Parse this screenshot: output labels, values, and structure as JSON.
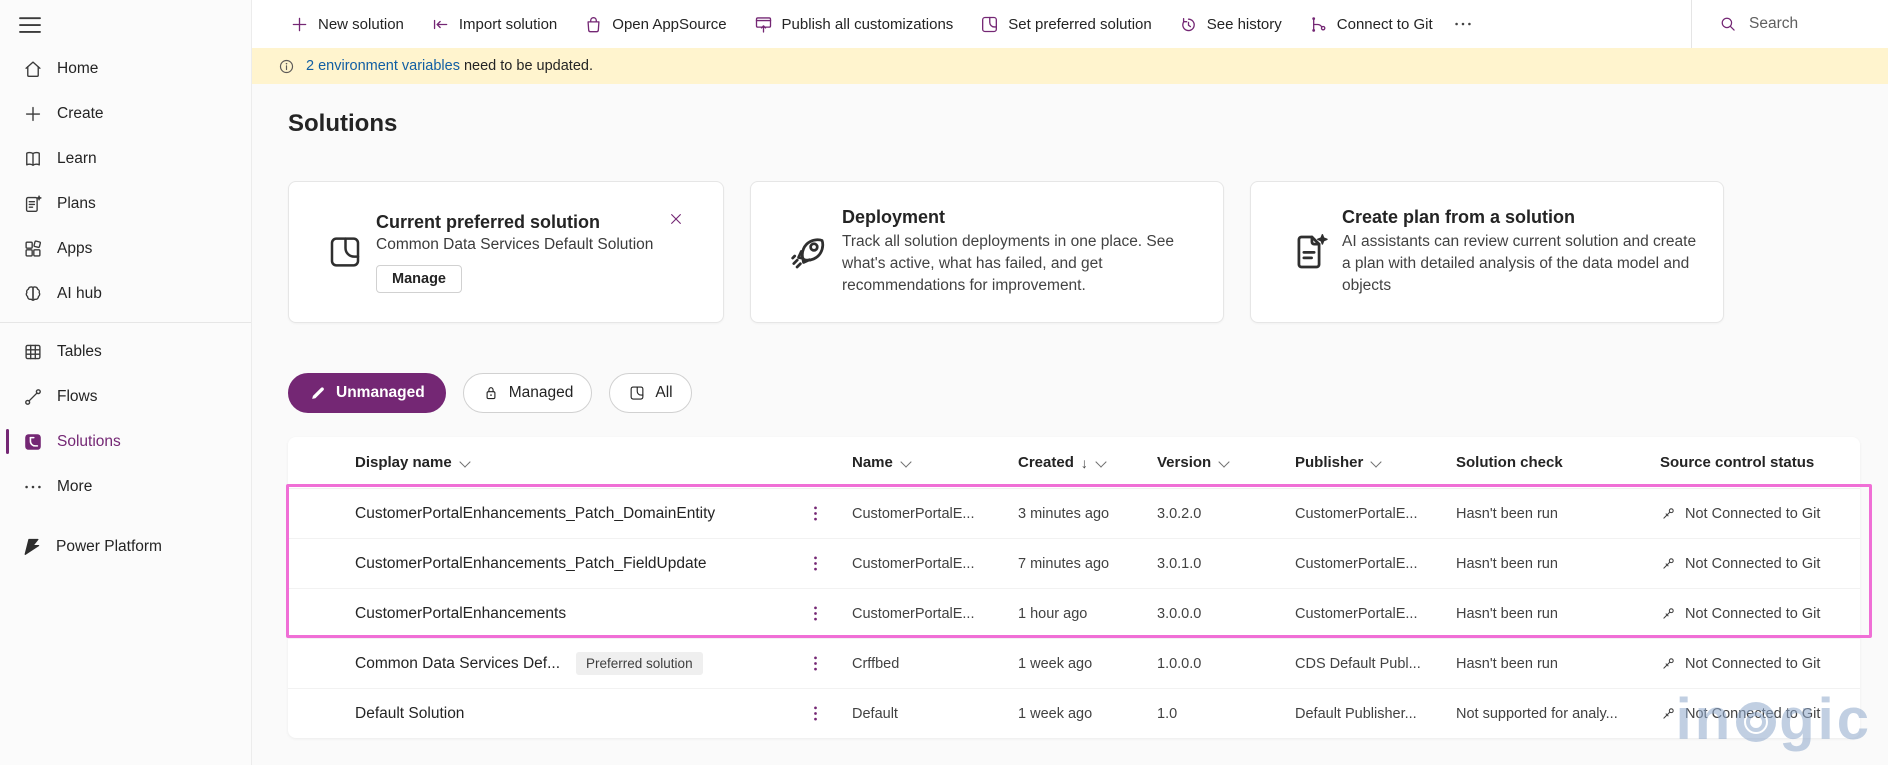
{
  "colors": {
    "accent": "#742774",
    "link": "#115ea3",
    "notification_bg": "#fff4ce",
    "highlight": "#f06fd6",
    "watermark": "#8fa9cc"
  },
  "topbar": {
    "actions": [
      {
        "label": "New solution",
        "icon": "plus-icon"
      },
      {
        "label": "Import solution",
        "icon": "import-icon"
      },
      {
        "label": "Open AppSource",
        "icon": "appsource-bag-icon"
      },
      {
        "label": "Publish all customizations",
        "icon": "publish-icon"
      },
      {
        "label": "Set preferred solution",
        "icon": "preferred-solution-icon"
      },
      {
        "label": "See history",
        "icon": "history-icon"
      },
      {
        "label": "Connect to Git",
        "icon": "git-branch-icon"
      }
    ],
    "search_placeholder": "Search"
  },
  "notification": {
    "link_text": "2 environment variables",
    "message": " need to be updated."
  },
  "sidebar": {
    "items": [
      {
        "label": "Home",
        "icon": "home-icon"
      },
      {
        "label": "Create",
        "icon": "plus-icon"
      },
      {
        "label": "Learn",
        "icon": "book-icon"
      },
      {
        "label": "Plans",
        "icon": "plans-icon"
      },
      {
        "label": "Apps",
        "icon": "apps-icon"
      },
      {
        "label": "AI hub",
        "icon": "ai-hub-icon"
      },
      {
        "divider": true
      },
      {
        "label": "Tables",
        "icon": "tables-icon"
      },
      {
        "label": "Flows",
        "icon": "flows-icon"
      },
      {
        "label": "Solutions",
        "icon": "solutions-icon",
        "selected": true
      },
      {
        "label": "More",
        "icon": "more-icon"
      }
    ],
    "footer": {
      "label": "Power Platform",
      "icon": "power-platform-icon"
    }
  },
  "page": {
    "title": "Solutions"
  },
  "cards": [
    {
      "title": "Current preferred solution",
      "subtitle": "Common Data Services Default Solution",
      "button_label": "Manage",
      "icon": "solution-box-icon"
    },
    {
      "title": "Deployment",
      "body": "Track all solution deployments in one place. See what's active, what has failed, and get recommendations for improvement.",
      "icon": "rocket-icon"
    },
    {
      "title": "Create plan from a solution",
      "body": "AI assistants can review current solution and create a plan with detailed analysis of the data model and objects",
      "icon": "plan-document-icon"
    }
  ],
  "filters": [
    {
      "label": "Unmanaged",
      "icon": "pencil-icon",
      "selected": true
    },
    {
      "label": "Managed",
      "icon": "lock-icon",
      "selected": false
    },
    {
      "label": "All",
      "icon": "solution-box-icon",
      "selected": false
    }
  ],
  "table": {
    "columns": [
      {
        "label": "Display name",
        "sortable": true
      },
      {
        "label": "Name",
        "sortable": true
      },
      {
        "label": "Created",
        "sortable": true,
        "sort": "desc"
      },
      {
        "label": "Version",
        "sortable": true
      },
      {
        "label": "Publisher",
        "sortable": true
      },
      {
        "label": "Solution check",
        "sortable": false
      },
      {
        "label": "Source control status",
        "sortable": false
      }
    ],
    "rows": [
      {
        "display_name": "CustomerPortalEnhancements_Patch_DomainEntity",
        "badge": "",
        "name": "CustomerPortalE...",
        "created": "3 minutes ago",
        "version": "3.0.2.0",
        "publisher": "CustomerPortalE...",
        "solution_check": "Hasn't been run",
        "source_control": "Not Connected to Git",
        "highlighted": true
      },
      {
        "display_name": "CustomerPortalEnhancements_Patch_FieldUpdate",
        "badge": "",
        "name": "CustomerPortalE...",
        "created": "7 minutes ago",
        "version": "3.0.1.0",
        "publisher": "CustomerPortalE...",
        "solution_check": "Hasn't been run",
        "source_control": "Not Connected to Git",
        "highlighted": true
      },
      {
        "display_name": "CustomerPortalEnhancements",
        "badge": "",
        "name": "CustomerPortalE...",
        "created": "1 hour ago",
        "version": "3.0.0.0",
        "publisher": "CustomerPortalE...",
        "solution_check": "Hasn't been run",
        "source_control": "Not Connected to Git",
        "highlighted": true
      },
      {
        "display_name": "Common Data Services Def...",
        "badge": "Preferred solution",
        "name": "Crffbed",
        "created": "1 week ago",
        "version": "1.0.0.0",
        "publisher": "CDS Default Publ...",
        "solution_check": "Hasn't been run",
        "source_control": "Not Connected to Git",
        "highlighted": false
      },
      {
        "display_name": "Default Solution",
        "badge": "",
        "name": "Default",
        "created": "1 week ago",
        "version": "1.0",
        "publisher": "Default Publisher...",
        "solution_check": "Not supported for analy...",
        "source_control": "Not Connected to Git",
        "highlighted": false
      }
    ]
  },
  "watermark": "inogic"
}
